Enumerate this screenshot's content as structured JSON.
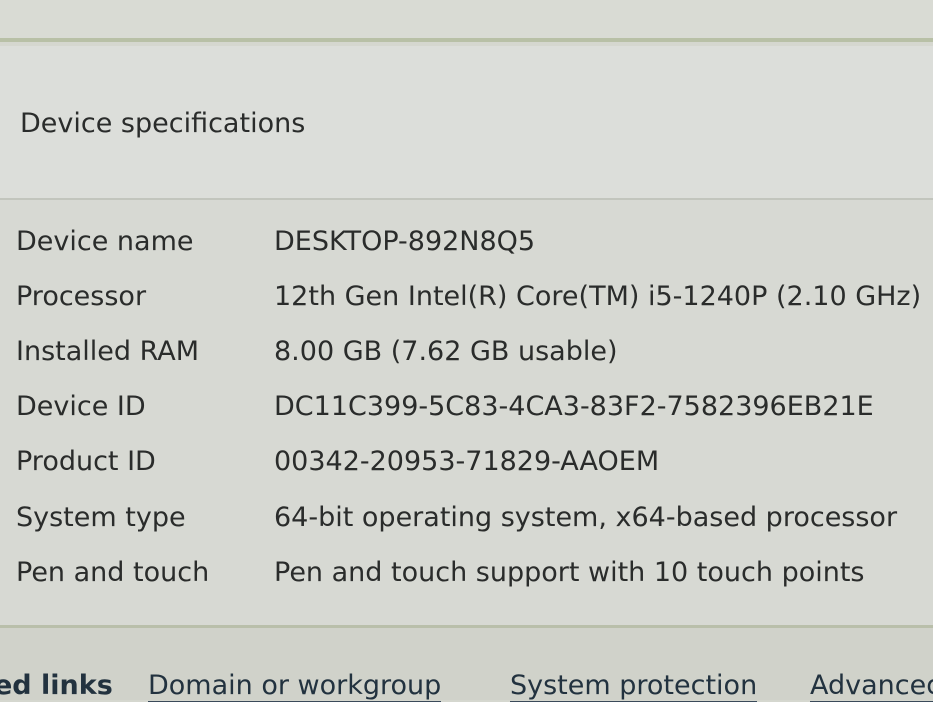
{
  "section_title": "Device specifications",
  "specs": [
    {
      "label": "Device name",
      "value": "DESKTOP-892N8Q5"
    },
    {
      "label": "Processor",
      "value": "12th Gen Intel(R) Core(TM) i5-1240P (2.10 GHz)"
    },
    {
      "label": "Installed RAM",
      "value": "8.00 GB (7.62 GB usable)"
    },
    {
      "label": "Device ID",
      "value": "DC11C399-5C83-4CA3-83F2-7582396EB21E"
    },
    {
      "label": "Product ID",
      "value": "00342-20953-71829-AAOEM"
    },
    {
      "label": "System type",
      "value": "64-bit operating system, x64-based processor"
    },
    {
      "label": "Pen and touch",
      "value": "Pen and touch support with 10 touch points"
    }
  ],
  "related_links": {
    "label": "ed links",
    "items": [
      "Domain or workgroup",
      "System protection",
      "Advanced"
    ]
  }
}
